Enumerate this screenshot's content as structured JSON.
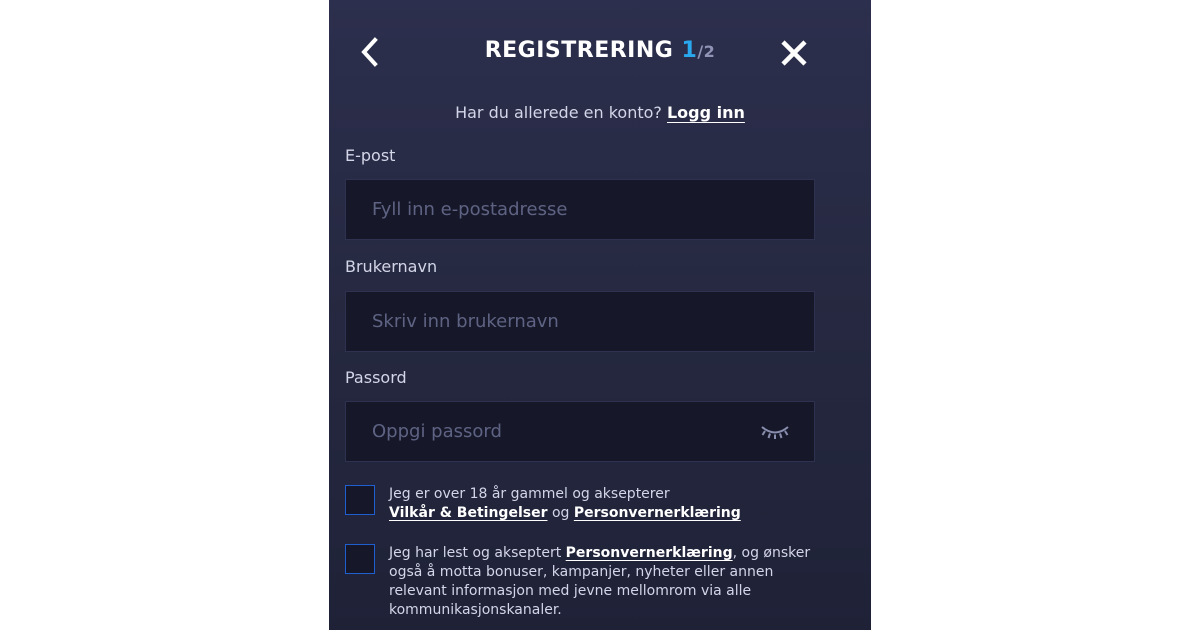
{
  "header": {
    "title": "REGISTRERING",
    "step_current": "1",
    "step_total": "/2"
  },
  "login": {
    "prompt": "Har du allerede en konto?",
    "link": "Logg inn"
  },
  "fields": {
    "email": {
      "label": "E-post",
      "placeholder": "Fyll inn e-postadresse",
      "value": ""
    },
    "username": {
      "label": "Brukernavn",
      "placeholder": "Skriv inn brukernavn",
      "value": ""
    },
    "password": {
      "label": "Passord",
      "placeholder": "Oppgi passord",
      "value": ""
    }
  },
  "consent_terms": {
    "text_before": "Jeg er over 18 år gammel og aksepterer",
    "link_terms": "Vilkår & Betingelser",
    "text_middle": "og",
    "link_privacy": "Personvernerklæring",
    "checked": false
  },
  "consent_marketing": {
    "text_before": "Jeg har lest og akseptert",
    "link_privacy": "Personvernerklæring",
    "text_after": ", og ønsker også å motta bonuser, kampanjer, nyheter eller annen relevant informasjon med jevne mellomrom via alle kommunikasjonskanaler.",
    "checked": false
  },
  "icons": {
    "back": "chevron-left-icon",
    "close": "close-icon",
    "password_visibility": "eye-closed-icon"
  },
  "colors": {
    "background": "#262941",
    "accent": "#29a8ee",
    "input_bg": "#161829",
    "checkbox_border": "#1f5fd0"
  }
}
